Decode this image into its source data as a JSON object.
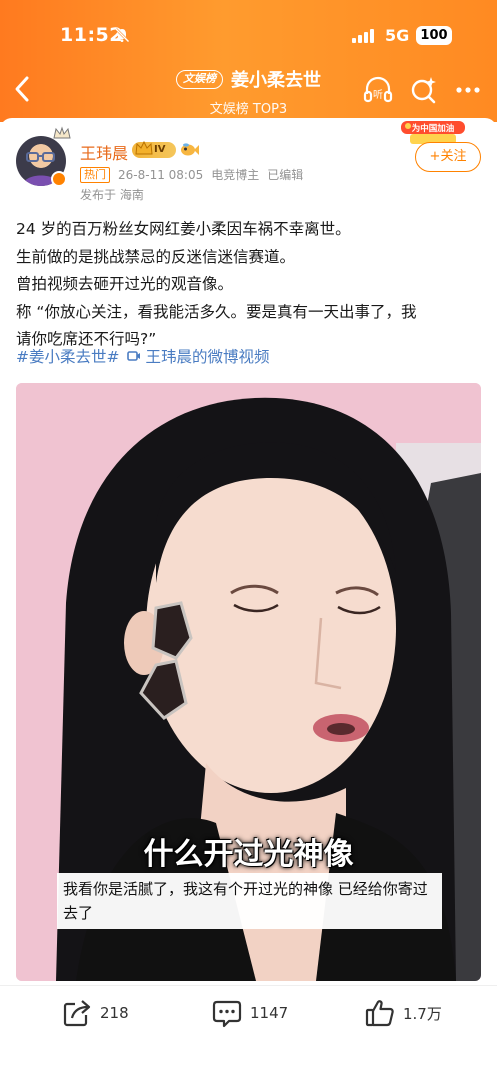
{
  "status_bar": {
    "time": "11:52",
    "network": "5G",
    "battery": "100"
  },
  "nav": {
    "tag": "文娱榜",
    "title": "姜小柔去世",
    "subtitle": "文娱榜 TOP3",
    "listen_label": "听"
  },
  "post": {
    "author": "王玮晨",
    "vip_level": "IV",
    "hot_tag": "热门",
    "date": "26-8-11 08:05",
    "author_role": "电竞博主",
    "edit_status": "已编辑",
    "location": "发布于 海南",
    "promo_label": "为中国加油",
    "follow_label": "+关注",
    "body_lines": [
      "24 岁的百万粉丝女网红姜小柔因车祸不幸离世。",
      "生前做的是挑战禁忌的反迷信迷信赛道。",
      "曾拍视频去砸开过光的观音像。",
      "称 “你放心关注，看我能活多久。要是真有一天出事了，我",
      "请你吃席还不行吗?”"
    ],
    "hashtag": "#姜小柔去世#",
    "video_link": "王玮晨的微博视频"
  },
  "video": {
    "caption_big": "什么开过光神像",
    "caption_small": "我看你是活腻了，我这有个开过光的神像 已经给你寄过去了"
  },
  "actions": {
    "share_count": "218",
    "comment_count": "1147",
    "like_count": "1.7万"
  },
  "colors": {
    "header_orange": "#ff8a22",
    "accent_orange": "#ff8200",
    "link_blue": "#4a7cc2"
  }
}
